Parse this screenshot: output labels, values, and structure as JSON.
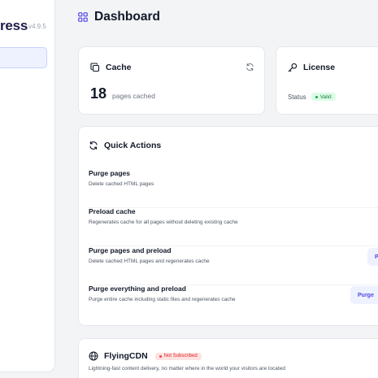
{
  "sidebar": {
    "brand_suffix": "ress",
    "version": "v4.9.5"
  },
  "header": {
    "title": "Dashboard",
    "icon": "grid-icon"
  },
  "cache_card": {
    "title": "Cache",
    "count": "18",
    "count_label": "pages cached",
    "icon": "copy-icon"
  },
  "license_card": {
    "title": "License",
    "status_label": "Status",
    "status_badge": "Valid",
    "icon": "key-icon"
  },
  "quick_actions": {
    "title": "Quick Actions",
    "icon": "refresh-icon",
    "items": [
      {
        "name": "Purge pages",
        "description": "Delete cached HTML pages",
        "button": ""
      },
      {
        "name": "Preload cache",
        "description": "Regenerates cache for all pages without deleting existing cache",
        "button": ""
      },
      {
        "name": "Purge pages and preload",
        "description": "Delete cached HTML pages and regenerates cache",
        "button": "P"
      },
      {
        "name": "Purge everything and preload",
        "description": "Purge entire cache including static files and regenerates cache",
        "button": "Purge"
      }
    ]
  },
  "cdn_card": {
    "title": "FlyingCDN",
    "badge": "Not Subscribed",
    "description": "Lightning-fast content delivery, no matter where in the world your visitors are located",
    "icon": "globe-icon"
  },
  "colors": {
    "accent": "#4f46e5",
    "accent_bg": "#eef2ff",
    "success": "#16a34a",
    "danger": "#dc2626",
    "page_bg": "#f3f4f6"
  }
}
